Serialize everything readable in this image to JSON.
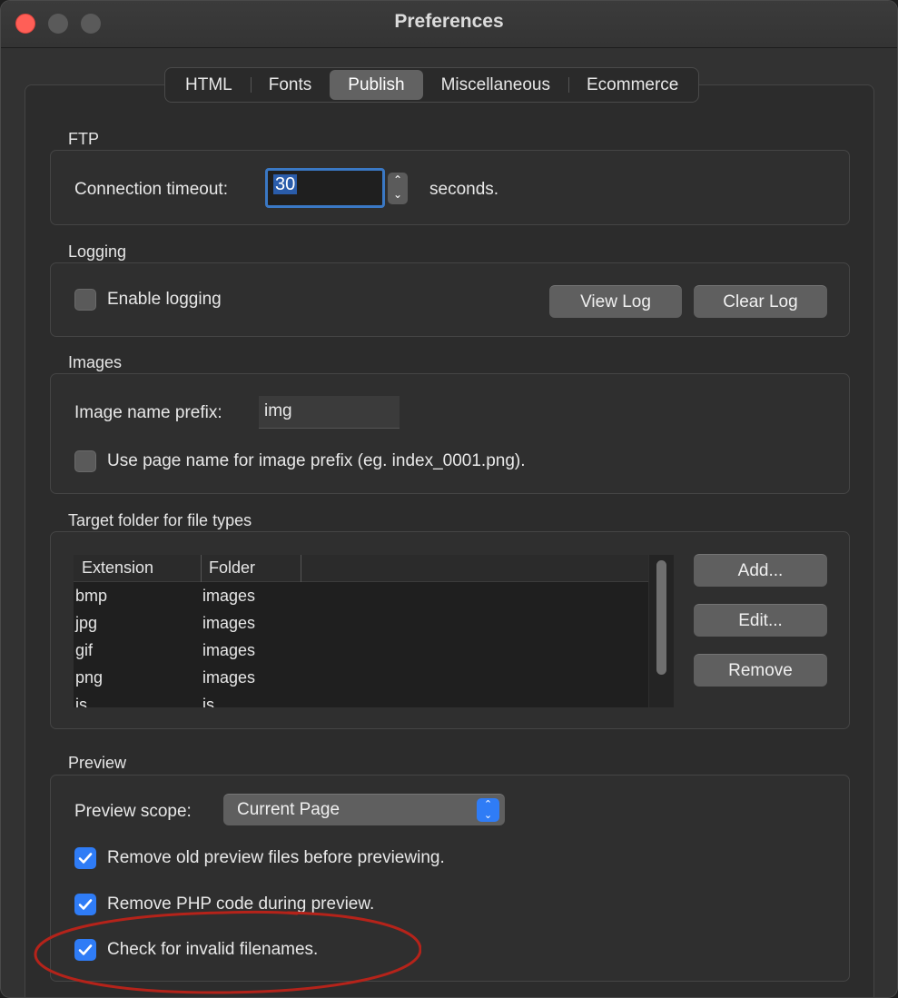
{
  "window": {
    "title": "Preferences"
  },
  "tabs": [
    {
      "label": "HTML",
      "active": false
    },
    {
      "label": "Fonts",
      "active": false
    },
    {
      "label": "Publish",
      "active": true
    },
    {
      "label": "Miscellaneous",
      "active": false
    },
    {
      "label": "Ecommerce",
      "active": false
    }
  ],
  "ftp": {
    "section_label": "FTP",
    "timeout_label": "Connection timeout:",
    "timeout_value": "30",
    "units_label": "seconds."
  },
  "logging": {
    "section_label": "Logging",
    "enable_label": "Enable logging",
    "enable_checked": false,
    "view_log_label": "View Log",
    "clear_log_label": "Clear Log"
  },
  "images": {
    "section_label": "Images",
    "prefix_label": "Image name prefix:",
    "prefix_value": "img",
    "use_page_name_label": "Use page name for image prefix (eg. index_0001.png).",
    "use_page_name_checked": false
  },
  "target_folder": {
    "section_label": "Target folder for file types",
    "columns": [
      "Extension",
      "Folder"
    ],
    "rows": [
      {
        "extension": "bmp",
        "folder": "images"
      },
      {
        "extension": "jpg",
        "folder": "images"
      },
      {
        "extension": "gif",
        "folder": "images"
      },
      {
        "extension": "png",
        "folder": "images"
      },
      {
        "extension": "js",
        "folder": "js"
      }
    ],
    "add_label": "Add...",
    "edit_label": "Edit...",
    "remove_label": "Remove"
  },
  "preview": {
    "section_label": "Preview",
    "scope_label": "Preview scope:",
    "scope_value": "Current Page",
    "remove_old_label": "Remove old preview files before previewing.",
    "remove_php_label": "Remove PHP code during preview.",
    "check_filenames_label": "Check for invalid filenames.",
    "remove_old_checked": true,
    "remove_php_checked": true,
    "check_filenames_checked": true
  },
  "colors": {
    "accent": "#2f7cf6",
    "annotation": "#b5231a",
    "close_button": "#ff5f57"
  }
}
